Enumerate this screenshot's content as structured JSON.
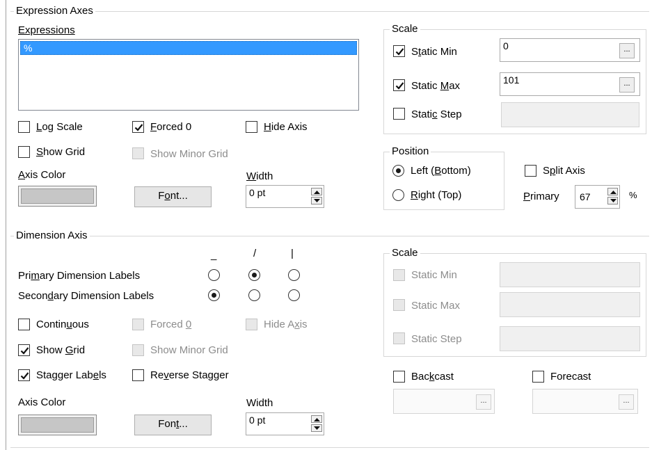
{
  "expression_axes": {
    "group_title": "Expression Axes",
    "expressions_label": "Expressions",
    "expressions_items": [
      "%"
    ],
    "log_scale": {
      "label": "Log Scale",
      "checked": false
    },
    "forced_0": {
      "label": "Forced 0",
      "checked": true
    },
    "hide_axis": {
      "label": "Hide Axis",
      "checked": false
    },
    "show_grid": {
      "label": "Show Grid",
      "checked": false
    },
    "show_minor_grid": {
      "label": "Show Minor Grid",
      "checked": false,
      "disabled": true
    },
    "axis_color_label": "Axis Color",
    "font_button": "Font...",
    "width_label": "Width",
    "width_value": "0 pt",
    "scale": {
      "title": "Scale",
      "static_min": {
        "label": "Static Min",
        "checked": true,
        "value": "0"
      },
      "static_max": {
        "label": "Static Max",
        "checked": true,
        "value": "101"
      },
      "static_step": {
        "label": "Static Step",
        "checked": false,
        "value": ""
      },
      "ellipsis": "..."
    },
    "position": {
      "title": "Position",
      "left_bottom": "Left (Bottom)",
      "right_top": "Right (Top)",
      "selected": "left_bottom"
    },
    "split_axis": {
      "label": "Split Axis",
      "checked": false
    },
    "primary_label": "Primary",
    "primary_value": "67",
    "percent": "%"
  },
  "dimension_axis": {
    "group_title": "Dimension Axis",
    "col_symbols": [
      "_",
      "/",
      "|"
    ],
    "primary_labels": {
      "label": "Primary Dimension Labels",
      "selected_index": 1
    },
    "secondary_labels": {
      "label": "Secondary Dimension Labels",
      "selected_index": 0
    },
    "continuous": {
      "label": "Continuous",
      "checked": false
    },
    "forced_0": {
      "label": "Forced 0",
      "checked": false,
      "disabled": true
    },
    "hide_axis": {
      "label": "Hide Axis",
      "checked": false,
      "disabled": true
    },
    "show_grid": {
      "label": "Show Grid",
      "checked": true
    },
    "show_minor_grid": {
      "label": "Show Minor Grid",
      "checked": false,
      "disabled": true
    },
    "stagger_labels": {
      "label": "Stagger Labels",
      "checked": true
    },
    "reverse_stagger": {
      "label": "Reverse Stagger",
      "checked": false
    },
    "axis_color_label": "Axis Color",
    "font_button": "Font...",
    "width_label": "Width",
    "width_value": "0 pt",
    "scale": {
      "title": "Scale",
      "static_min": {
        "label": "Static Min",
        "checked": false
      },
      "static_max": {
        "label": "Static Max",
        "checked": false
      },
      "static_step": {
        "label": "Static Step",
        "checked": false
      }
    },
    "backcast": {
      "label": "Backcast",
      "checked": false
    },
    "forecast": {
      "label": "Forecast",
      "checked": false
    },
    "ellipsis": "..."
  }
}
